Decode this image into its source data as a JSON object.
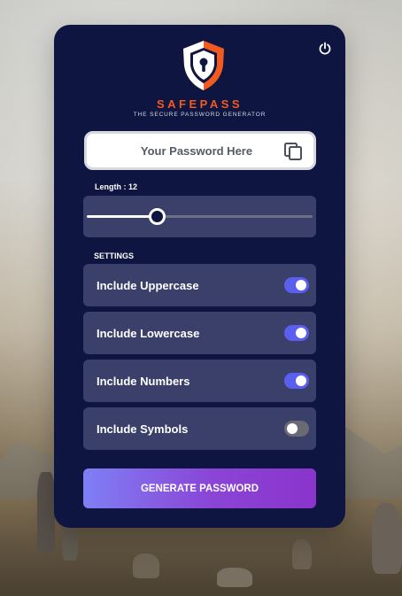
{
  "app": {
    "brand": "SAFEPASS",
    "tagline": "THE SECURE PASSWORD GENERATOR"
  },
  "password": {
    "placeholder": "Your Password Here"
  },
  "length": {
    "label": "Length : 12",
    "value": 12,
    "fraction": 0.31
  },
  "settings": {
    "heading": "SETTINGS",
    "options": [
      {
        "label": "Include Uppercase",
        "enabled": true
      },
      {
        "label": "Include Lowercase",
        "enabled": true
      },
      {
        "label": "Include Numbers",
        "enabled": true
      },
      {
        "label": "Include Symbols",
        "enabled": false
      }
    ]
  },
  "actions": {
    "generate_label": "GENERATE PASSWORD"
  },
  "icons": {
    "power": "power-icon",
    "copy": "copy-icon",
    "logo": "shield-lock-logo"
  },
  "colors": {
    "card": "#0e1540",
    "panel": "#3a406a",
    "brand": "#f25a1f",
    "toggle_on": "#5b5ff0",
    "toggle_off": "#6a6a72"
  }
}
